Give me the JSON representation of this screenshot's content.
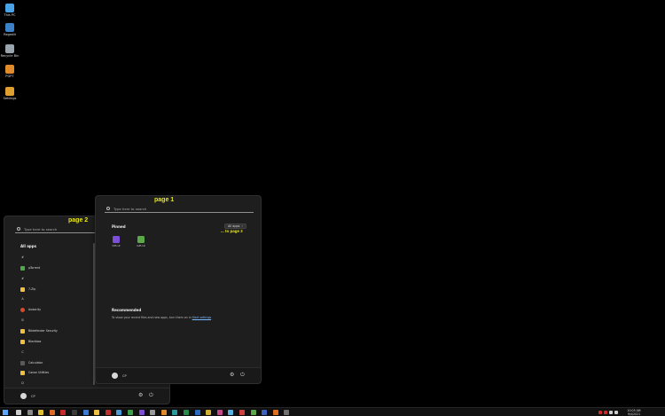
{
  "desktop_icons": [
    {
      "label": "This PC",
      "icon": "computer-icon",
      "color": "#4aa3e6"
    },
    {
      "label": "Regedit",
      "icon": "regedit-icon",
      "color": "#3b82c8"
    },
    {
      "label": "Recycle Bin",
      "icon": "recycle-bin-icon",
      "color": "#9aa4ad"
    },
    {
      "label": "PGP7",
      "icon": "pgp-icon",
      "color": "#e08b2a"
    },
    {
      "label": "Settings",
      "icon": "settings-gear-icon",
      "color": "#e0a030"
    }
  ],
  "annotations": {
    "page1": "page 1",
    "page2": "page 2",
    "to_page2": "... to page 2"
  },
  "menu1": {
    "search_placeholder": "Type here to search",
    "pinned_title": "Pinned",
    "all_apps_button": "All apps",
    "all_apps_chevron": "›",
    "pinned_apps": [
      {
        "label": "CPU-Z",
        "icon": "cpu-z-icon",
        "color": "#7c4fd6"
      },
      {
        "label": "GPU-Z",
        "icon": "gpu-z-icon",
        "color": "#5aa84a"
      }
    ],
    "recommended_title": "Recommended",
    "recommended_text": "To show your recent files and new apps, turn them on in",
    "recommended_link": "Start settings",
    "user_name": "CP"
  },
  "menu2": {
    "search_placeholder": "Type here to search",
    "all_apps_title": "All apps",
    "apps": [
      {
        "type": "letter",
        "label": "#"
      },
      {
        "type": "app",
        "label": "µTorrent",
        "icon": "utorrent-icon",
        "color": "#4fa84a"
      },
      {
        "type": "letter",
        "label": "#"
      },
      {
        "type": "app",
        "label": "7-Zip",
        "icon": "folder-icon",
        "color": "#f0c040"
      },
      {
        "type": "letter",
        "label": "A"
      },
      {
        "type": "app",
        "label": "Audacity",
        "icon": "audacity-icon",
        "color": "#d94a2a"
      },
      {
        "type": "letter",
        "label": "B"
      },
      {
        "type": "app",
        "label": "Bitdefender Security",
        "icon": "folder-icon",
        "color": "#f0c040"
      },
      {
        "type": "app",
        "label": "Blackbox",
        "icon": "folder-icon",
        "color": "#f0c040"
      },
      {
        "type": "letter",
        "label": "C"
      },
      {
        "type": "app",
        "label": "Calculator",
        "icon": "calculator-icon",
        "color": "#5a5a5a"
      },
      {
        "type": "app",
        "label": "Canon Utilities",
        "icon": "folder-icon",
        "color": "#f0c040"
      },
      {
        "type": "letter",
        "label": "D"
      }
    ],
    "user_name": "CP"
  },
  "taskbar": {
    "icons": [
      {
        "icon": "search-icon",
        "color": "#cccccc"
      },
      {
        "icon": "task-view-icon",
        "color": "#888888"
      },
      {
        "icon": "chrome-icon",
        "color": "#e0c030"
      },
      {
        "icon": "firefox-icon",
        "color": "#e06a2a"
      },
      {
        "icon": "app-red-icon",
        "color": "#cc2a2a"
      },
      {
        "icon": "terminal-icon",
        "color": "#3a3a3a"
      },
      {
        "icon": "app-blue-icon",
        "color": "#3a7ad6"
      },
      {
        "icon": "explorer-icon",
        "color": "#f0c040"
      },
      {
        "icon": "app-red2-icon",
        "color": "#c0302a"
      },
      {
        "icon": "media-icon",
        "color": "#4a9ad6"
      },
      {
        "icon": "app-green-icon",
        "color": "#3aa04a"
      },
      {
        "icon": "app-purple-icon",
        "color": "#7c4fd6"
      },
      {
        "icon": "app-gray-icon",
        "color": "#9a9a9a"
      },
      {
        "icon": "app-orange-icon",
        "color": "#e08b2a"
      },
      {
        "icon": "app-teal-icon",
        "color": "#2a9a9a"
      },
      {
        "icon": "excel-icon",
        "color": "#2a8a4a"
      },
      {
        "icon": "app-blue2-icon",
        "color": "#2a6ac0"
      },
      {
        "icon": "app-yellow-icon",
        "color": "#d0b030"
      },
      {
        "icon": "app-pink-icon",
        "color": "#c04a8a"
      },
      {
        "icon": "app-lightblue-icon",
        "color": "#5ab0e0"
      },
      {
        "icon": "app-red3-icon",
        "color": "#d04040"
      },
      {
        "icon": "app-green2-icon",
        "color": "#5aa84a"
      },
      {
        "icon": "app-blue3-icon",
        "color": "#4060c0"
      },
      {
        "icon": "app-orange2-icon",
        "color": "#e07020"
      },
      {
        "icon": "app-gray2-icon",
        "color": "#707070"
      }
    ],
    "tray_icons": [
      {
        "icon": "tray-red-icon",
        "color": "#cc2a2a"
      },
      {
        "icon": "tray-red2-icon",
        "color": "#cc2a2a"
      },
      {
        "icon": "tray-network-icon",
        "color": "#cccccc"
      },
      {
        "icon": "tray-volume-icon",
        "color": "#cccccc"
      }
    ],
    "time": "10:05 AM",
    "date": "9/4/2021"
  }
}
